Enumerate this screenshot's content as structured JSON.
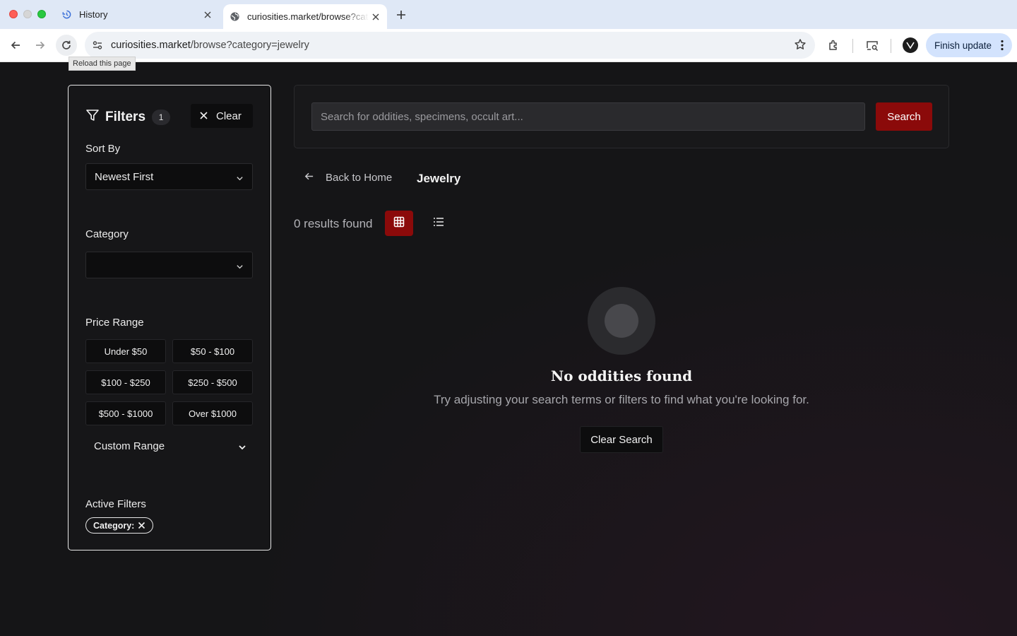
{
  "browser": {
    "tabs": [
      {
        "title": "History",
        "icon": "history-icon"
      },
      {
        "title": "curiosities.market/browse?category=jewelry",
        "icon": "globe-icon"
      }
    ],
    "url_host": "curiosities.market",
    "url_path": "/browse?category=jewelry",
    "tooltip": "Reload this page",
    "update_label": "Finish update"
  },
  "search": {
    "placeholder": "Search for oddities, specimens, occult art...",
    "value": "",
    "button_label": "Search"
  },
  "filters": {
    "title": "Filters",
    "count": "1",
    "clear_label": "Clear",
    "sort_label": "Sort By",
    "sort_value": "Newest First",
    "category_label": "Category",
    "category_value": "",
    "price_label": "Price Range",
    "price_options": [
      "Under $50",
      "$50 - $100",
      "$100 - $250",
      "$250 - $500",
      "$500 - $1000",
      "Over $1000"
    ],
    "custom_range_label": "Custom Range",
    "active_label": "Active Filters",
    "active_chip": "Category:"
  },
  "breadcrumb": {
    "back_label": "Back to Home",
    "current": "Jewelry"
  },
  "results": {
    "count_text": "0 results found",
    "view_mode": "grid"
  },
  "empty_state": {
    "title": "No oddities found",
    "subtitle": "Try adjusting your search terms or filters to find what you're looking for.",
    "button_label": "Clear Search"
  },
  "colors": {
    "accent": "#8b0a0a",
    "background": "#151517",
    "panel_border": "#e8e8e8"
  }
}
